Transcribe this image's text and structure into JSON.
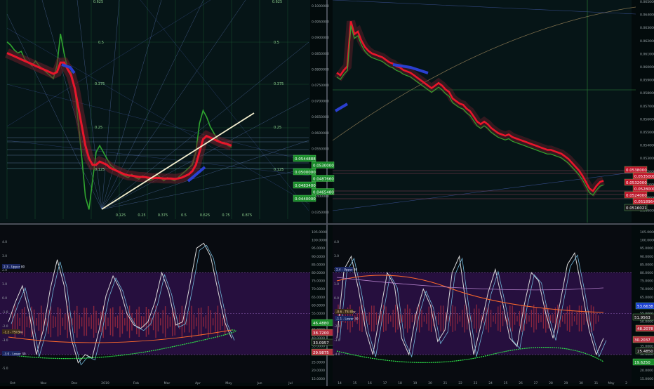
{
  "colors": {
    "background": "#061517",
    "grid": "#1c3a3a",
    "price": "#2fa52f",
    "ribbon_red": "#e8162b",
    "ribbon_blue": "#2a3fd0",
    "trendline": "#f4efcf",
    "osc_zone": "#2a0f44",
    "osc_red": "#b5303f",
    "osc_green": "#2ee54a",
    "osc_white": "#d9d9d9",
    "orange": "#ff6a2b",
    "sep": "#4a4f5a"
  },
  "chart_data": [
    {
      "panel": "left-top",
      "type": "line",
      "price_axis_labels": [
        "0.1000000",
        "0.0950000",
        "0.0900000",
        "0.0850000",
        "0.0800000",
        "0.0750000",
        "0.0700000",
        "0.0650000",
        "0.0600000",
        "0.0550000",
        "0.0500000",
        "0.0450000",
        "0.0400000",
        "0.0350000"
      ],
      "price_badges": [
        {
          "text": "0.0544888",
          "color": "#1a8a2b"
        },
        {
          "text": "0.0530000",
          "color": "#1a8a2b"
        },
        {
          "text": "0.0500000",
          "color": "#1a8a2b"
        },
        {
          "text": "0.0487660",
          "color": "#1a8a2b"
        },
        {
          "text": "0.0483400",
          "color": "#1a8a2b"
        },
        {
          "text": "0.0465480",
          "color": "#1a8a2b"
        },
        {
          "text": "0.0440000",
          "color": "#1a8a2b"
        }
      ],
      "fib_labels": [
        "0.125",
        "0.25",
        "0.375",
        "0.5",
        "0.625",
        "0.75",
        "0.875"
      ],
      "top_labels": [
        "0.625",
        "0.625"
      ],
      "grid_labels": [
        "0.5",
        "0.5",
        "0.375",
        "0.375",
        "0.25",
        "0.25",
        "0.125",
        "0.125"
      ],
      "x_labels": [
        "Oct",
        "Nov",
        "Dec",
        "2019",
        "Feb",
        "Mar",
        "Apr",
        "May",
        "Jun",
        "Jul"
      ],
      "x": [
        0,
        5,
        10,
        15,
        20,
        25,
        30,
        35,
        40,
        45,
        50,
        55,
        60,
        65,
        70,
        75,
        80,
        85,
        90,
        95,
        100,
        105,
        110,
        115,
        120,
        125,
        130,
        135,
        140,
        145,
        150,
        155,
        160,
        165,
        170,
        175,
        180,
        185,
        190,
        195,
        200,
        205,
        210,
        215,
        220,
        225,
        230,
        235,
        240,
        245,
        250,
        255,
        260,
        265,
        270,
        275,
        280,
        285,
        290,
        295,
        300,
        305,
        310,
        315
      ],
      "price": [
        0.0905,
        0.0895,
        0.088,
        0.087,
        0.0875,
        0.085,
        0.084,
        0.083,
        0.0845,
        0.083,
        0.082,
        0.081,
        0.08,
        0.079,
        0.083,
        0.093,
        0.087,
        0.082,
        0.081,
        0.076,
        0.065,
        0.054,
        0.042,
        0.038,
        0.047,
        0.056,
        0.058,
        0.056,
        0.054,
        0.052,
        0.051,
        0.05,
        0.049,
        0.0485,
        0.048,
        0.049,
        0.048,
        0.0475,
        0.0485,
        0.048,
        0.047,
        0.0475,
        0.049,
        0.048,
        0.047,
        0.048,
        0.0475,
        0.047,
        0.048,
        0.049,
        0.05,
        0.051,
        0.052,
        0.056,
        0.065,
        0.069,
        0.067,
        0.064,
        0.062,
        0.06,
        0.059,
        0.059,
        0.058,
        0.0575
      ],
      "ma": [
        0.087,
        0.0865,
        0.086,
        0.0855,
        0.085,
        0.0845,
        0.084,
        0.0835,
        0.083,
        0.0825,
        0.082,
        0.0815,
        0.081,
        0.0805,
        0.081,
        0.084,
        0.084,
        0.082,
        0.08,
        0.076,
        0.07,
        0.064,
        0.058,
        0.054,
        0.052,
        0.052,
        0.053,
        0.0525,
        0.052,
        0.051,
        0.0505,
        0.05,
        0.0495,
        0.049,
        0.0487,
        0.0486,
        0.0484,
        0.0482,
        0.0482,
        0.0481,
        0.0479,
        0.0478,
        0.0479,
        0.0478,
        0.0477,
        0.0477,
        0.0477,
        0.0476,
        0.0477,
        0.048,
        0.0485,
        0.049,
        0.05,
        0.052,
        0.056,
        0.06,
        0.061,
        0.0605,
        0.06,
        0.0595,
        0.059,
        0.0587,
        0.0584,
        0.058
      ]
    },
    {
      "panel": "right-top",
      "type": "line",
      "price_axis_labels": [
        "0.0650000",
        "0.0640000",
        "0.0630000",
        "0.0620000",
        "0.0610000",
        "0.0600000",
        "0.0590000",
        "0.0580000",
        "0.0570000",
        "0.0560000",
        "0.0550000",
        "0.0540000",
        "0.0530000",
        "0.0520000",
        "0.0510000",
        "0.0500000",
        "0.0490000"
      ],
      "price_badges": [
        {
          "text": "0.0538000",
          "color": "#c0162b"
        },
        {
          "text": "0.0535000",
          "color": "#c0162b"
        },
        {
          "text": "0.0532000",
          "color": "#c0162b"
        },
        {
          "text": "0.0528000",
          "color": "#c0162b"
        },
        {
          "text": "0.0524000",
          "color": "#c0162b"
        },
        {
          "text": "0.0518964",
          "color": "#c0162b"
        },
        {
          "text": "0.0516021",
          "color": "#1a1a1a"
        }
      ],
      "x": [
        0,
        5,
        10,
        15,
        20,
        25,
        30,
        35,
        40,
        45,
        50,
        55,
        60,
        65,
        70,
        75,
        80,
        85,
        90,
        95,
        100,
        105,
        110,
        115,
        120,
        125,
        130,
        135,
        140,
        145,
        150,
        155,
        160,
        165,
        170,
        175,
        180,
        185,
        190,
        195,
        200,
        205,
        210,
        215,
        220,
        225,
        230,
        235,
        240,
        245,
        250,
        255,
        260,
        265,
        270,
        275,
        280,
        285,
        290,
        295,
        300,
        305,
        310,
        315,
        320,
        325,
        330,
        335,
        340,
        345,
        350,
        355,
        360,
        365,
        370,
        375,
        380
      ],
      "price": [
        0.06,
        0.0598,
        0.0602,
        0.0605,
        0.064,
        0.063,
        0.0632,
        0.0625,
        0.062,
        0.0617,
        0.0615,
        0.0614,
        0.0613,
        0.0612,
        0.061,
        0.0608,
        0.0607,
        0.0605,
        0.0604,
        0.0602,
        0.0601,
        0.06,
        0.0598,
        0.0596,
        0.0594,
        0.0592,
        0.059,
        0.0588,
        0.059,
        0.0592,
        0.059,
        0.0587,
        0.0585,
        0.058,
        0.0578,
        0.0576,
        0.0575,
        0.0572,
        0.057,
        0.0566,
        0.0562,
        0.056,
        0.0562,
        0.056,
        0.0557,
        0.0555,
        0.0553,
        0.0552,
        0.0551,
        0.0552,
        0.055,
        0.0549,
        0.0548,
        0.0547,
        0.0546,
        0.0545,
        0.0544,
        0.0543,
        0.0542,
        0.0541,
        0.054,
        0.054,
        0.0539,
        0.0538,
        0.0537,
        0.0535,
        0.0533,
        0.053,
        0.0527,
        0.0524,
        0.052,
        0.0515,
        0.051,
        0.0508,
        0.0512,
        0.0515,
        0.0516
      ]
    },
    {
      "panel": "left-bottom",
      "type": "line",
      "axis_labels": [
        "105.0000",
        "100.0000",
        "95.0000",
        "90.0000",
        "85.0000",
        "80.0000",
        "75.0000",
        "70.0000",
        "65.0000",
        "60.0000",
        "55.0000",
        "50.0000",
        "45.0000",
        "40.0000",
        "35.0000",
        "30.0000",
        "25.0000",
        "20.0000",
        "15.0000"
      ],
      "left_axis_labels": [
        "4.0",
        "3.0",
        "2.0",
        "1.0",
        "0.0",
        "-1.0",
        "-2.0",
        "-3.0",
        "-4.0",
        "-5.0"
      ],
      "badges": [
        {
          "text": "46.4880",
          "color": "#1a8a2b"
        },
        {
          "text": "38.7200",
          "color": "#b5303f"
        },
        {
          "text": "33.0957",
          "color": "#1a1a1a"
        },
        {
          "text": "29.9875",
          "color": "#b5303f"
        }
      ],
      "legend_upper": "2.3 - Upper 80",
      "legend_lower": "-3.0 - Lower 30",
      "legend_mid": "-1.2 - TSI Blw",
      "zone": [
        30,
        80
      ],
      "x": [
        0,
        10,
        20,
        30,
        40,
        50,
        60,
        70,
        80,
        90,
        100,
        110,
        120,
        130,
        140,
        150,
        160,
        170,
        180,
        190,
        200,
        210,
        220,
        230,
        240,
        250,
        260,
        270,
        280,
        290,
        300,
        310,
        320
      ],
      "osc": [
        50,
        62,
        72,
        55,
        30,
        45,
        70,
        88,
        72,
        40,
        25,
        30,
        28,
        45,
        66,
        78,
        70,
        55,
        48,
        46,
        50,
        62,
        80,
        68,
        48,
        50,
        72,
        95,
        98,
        90,
        70,
        50,
        40
      ]
    },
    {
      "panel": "right-bottom",
      "type": "line",
      "axis_labels": [
        "105.0000",
        "100.0000",
        "95.0000",
        "90.0000",
        "85.0000",
        "80.0000",
        "75.0000",
        "70.0000",
        "65.0000",
        "60.0000",
        "55.0000",
        "50.0000",
        "45.0000",
        "40.0000",
        "35.0000",
        "30.0000",
        "25.0000",
        "20.0000",
        "15.0000"
      ],
      "left_axis_labels": [
        "4.0",
        "3.0",
        "2.0",
        "1.0",
        "0.0",
        "-1.0",
        "-2.0",
        "-3.0",
        "-4.0"
      ],
      "badges": [
        {
          "text": "53.6638",
          "color": "#1a3fd0"
        },
        {
          "text": "51.9563",
          "color": "#1a1a1a"
        },
        {
          "text": "48.2078",
          "color": "#b5303f"
        },
        {
          "text": "30.2037",
          "color": "#b5303f"
        },
        {
          "text": "25.4850",
          "color": "#1a1a1a"
        },
        {
          "text": "19.6250",
          "color": "#1a8a2b"
        }
      ],
      "legend_upper": "2.4 - Upper 80",
      "legend_mid": "-0.6 - TSI Blw",
      "legend_lower": "-1.1 - Lower 30",
      "zone": [
        30,
        80
      ],
      "x_labels": [
        "14",
        "15",
        "16",
        "17",
        "18",
        "19",
        "20",
        "21",
        "22",
        "23",
        "24",
        "25",
        "26",
        "27",
        "28",
        "29",
        "30",
        "31",
        "May",
        "2"
      ],
      "x": [
        0,
        10,
        20,
        30,
        40,
        50,
        60,
        70,
        80,
        90,
        100,
        110,
        120,
        130,
        140,
        150,
        160,
        170,
        180,
        190,
        200,
        210,
        220,
        230,
        240,
        250,
        260,
        270,
        280,
        290,
        300,
        310,
        320,
        330,
        340,
        350,
        360,
        370
      ],
      "osc": [
        40,
        82,
        90,
        70,
        45,
        30,
        55,
        80,
        72,
        40,
        30,
        55,
        70,
        60,
        38,
        45,
        80,
        90,
        58,
        30,
        48,
        68,
        82,
        62,
        40,
        35,
        60,
        80,
        75,
        55,
        40,
        62,
        85,
        92,
        70,
        45,
        30,
        40
      ]
    }
  ]
}
